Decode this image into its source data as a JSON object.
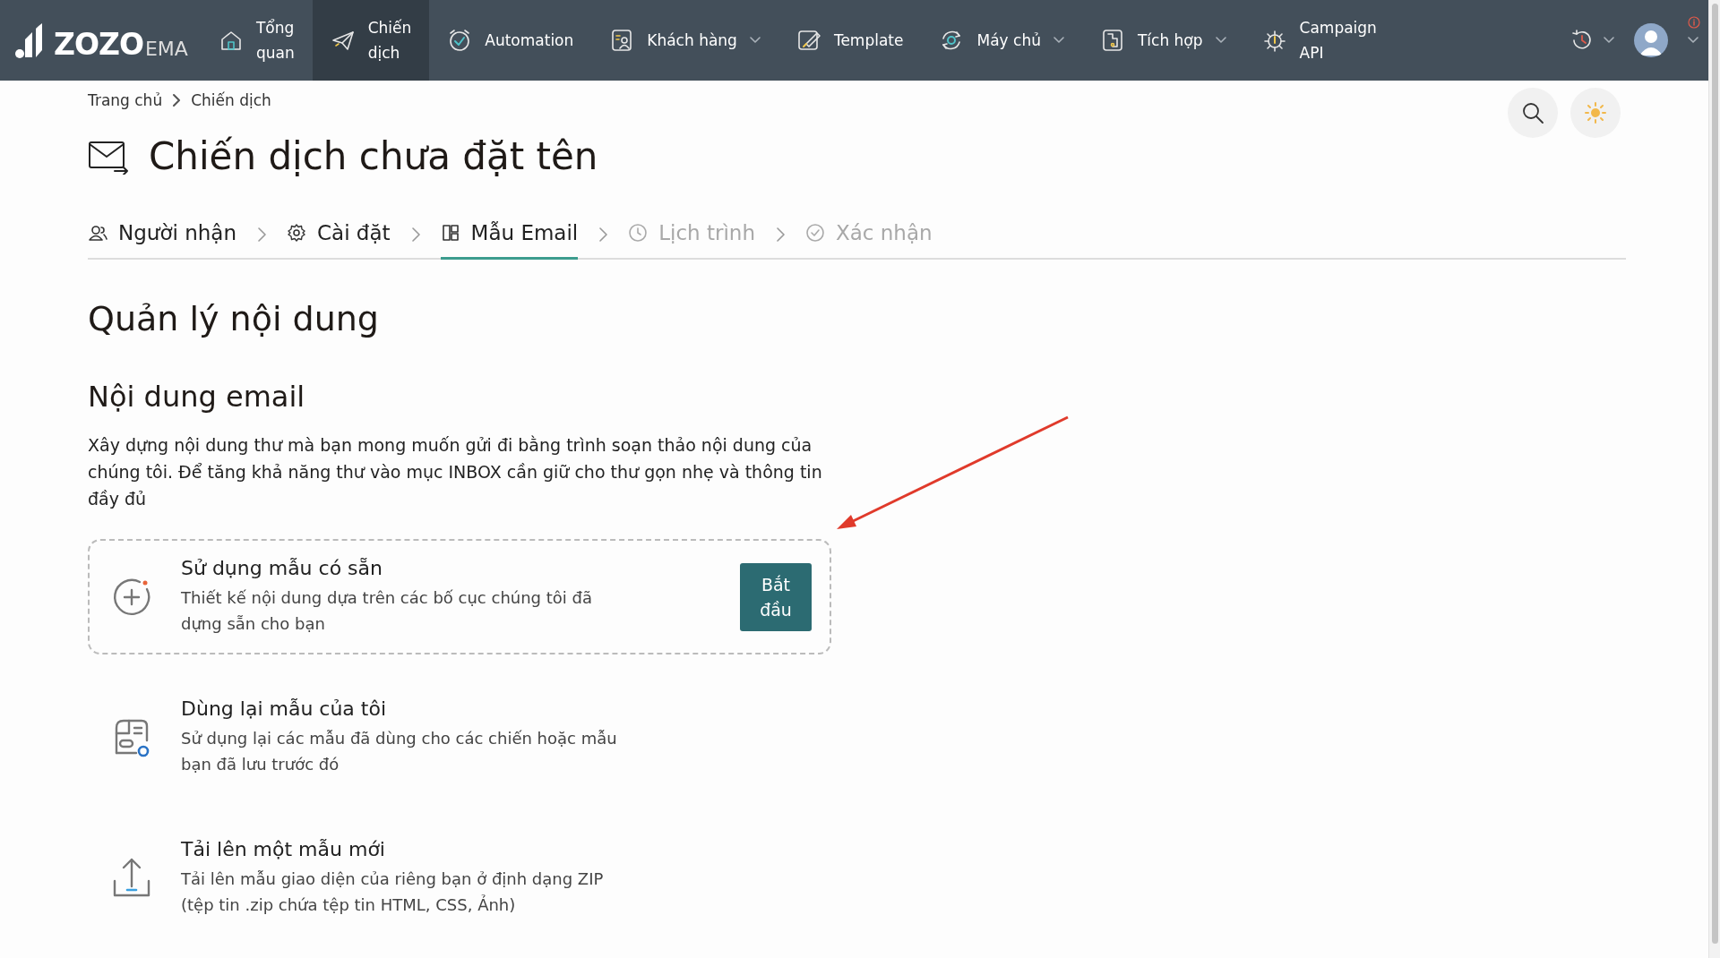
{
  "logo": {
    "brand": "ZOZO",
    "suffix": "EMA"
  },
  "nav": [
    {
      "label": "Tổng quan",
      "selected": false,
      "dropdown": false
    },
    {
      "label": "Chiến dịch",
      "selected": true,
      "dropdown": false
    },
    {
      "label": "Automation",
      "selected": false,
      "dropdown": false
    },
    {
      "label": "Khách hàng",
      "selected": false,
      "dropdown": true
    },
    {
      "label": "Template",
      "selected": false,
      "dropdown": false
    },
    {
      "label": "Máy chủ",
      "selected": false,
      "dropdown": true
    },
    {
      "label": "Tích hợp",
      "selected": false,
      "dropdown": true
    },
    {
      "label": "Campaign API",
      "selected": false,
      "dropdown": false
    }
  ],
  "breadcrumb": [
    "Trang chủ",
    "Chiến dịch"
  ],
  "title": "Chiến dịch chưa đặt tên",
  "steps": [
    {
      "label": "Người nhận",
      "selected": false,
      "disabled": false
    },
    {
      "label": "Cài đặt",
      "selected": false,
      "disabled": false
    },
    {
      "label": "Mẫu Email",
      "selected": true,
      "disabled": false
    },
    {
      "label": "Lịch trình",
      "selected": false,
      "disabled": true
    },
    {
      "label": "Xác nhận",
      "selected": false,
      "disabled": true
    }
  ],
  "heading": "Quản lý nội dung",
  "subheading": "Nội dung email",
  "description": "Xây dựng nội dung thư mà bạn mong muốn gửi đi bằng trình soạn thảo nội dung của chúng tôi. Để tăng khả năng thư vào mục INBOX cần giữ cho thư gọn nhẹ và thông tin đầy đủ",
  "options": [
    {
      "kind": "template",
      "title": "Sử dụng mẫu có sẵn",
      "text": "Thiết kế nội dung dựa trên các bố cục chúng tôi đã dựng sẵn cho bạn",
      "highlighted": true,
      "button": "Bắt đầu"
    },
    {
      "kind": "reuse",
      "title": "Dùng lại mẫu của tôi",
      "text": "Sử dụng lại các mẫu đã dùng cho các chiến hoặc mẫu bạn đã lưu trước đó",
      "highlighted": false
    },
    {
      "kind": "upload",
      "title": "Tải lên một mẫu mới",
      "text": "Tải lên mẫu giao diện của riêng bạn ở định dạng ZIP (tệp tin .zip chứa tệp tin HTML, CSS, Ảnh)",
      "highlighted": false
    }
  ]
}
